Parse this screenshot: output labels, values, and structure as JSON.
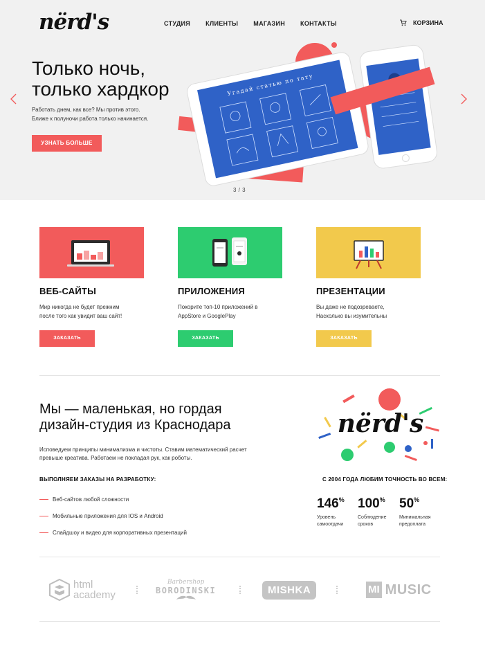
{
  "header": {
    "logo_text": "nërd's",
    "nav": [
      "СТУДИЯ",
      "КЛИЕНТЫ",
      "МАГАЗИН",
      "КОНТАКТЫ"
    ],
    "cart_label": "КОРЗИНА"
  },
  "hero": {
    "title_line1": "Только ночь,",
    "title_line2": "только хардкор",
    "text_line1": "Работать днем, как все? Мы против этого.",
    "text_line2": "Ближе к полуночи работа только начинается.",
    "button": "УЗНАТЬ БОЛЬШЕ",
    "pager": "3 / 3",
    "tablet_heading": "Угадай статью по тату",
    "accent_color": "#f25b5b"
  },
  "services": [
    {
      "title": "ВЕБ-САЙТЫ",
      "text_line1": "Мир никогда не будет прежним",
      "text_line2": "после того как увидит ваш сайт!",
      "button": "ЗАКАЗАТЬ",
      "color": "#f25b5b"
    },
    {
      "title": "ПРИЛОЖЕНИЯ",
      "text_line1": "Покорите топ-10 приложений в",
      "text_line2": "AppStore и GooglePlay",
      "button": "ЗАКАЗАТЬ",
      "color": "#2dcc70"
    },
    {
      "title": "ПРЕЗЕНТАЦИИ",
      "text_line1": "Вы даже не подозреваете,",
      "text_line2": "Насколько вы изумительны",
      "button": "ЗАКАЗАТЬ",
      "color": "#f2c94c"
    }
  ],
  "about": {
    "title_line1": "Мы — маленькая, но гордая",
    "title_line2": "дизайн-студия из Краснодара",
    "text_line1": "Исповедуем принципы минимализма и чистоты. Ставим математический расчет",
    "text_line2": "превыше креатива. Работаем не покладая рук, как роботы.",
    "orders_title": "ВЫПОЛНЯЕМ ЗАКАЗЫ НА РАЗРАБОТКУ:",
    "orders": [
      "Веб-сайтов любой сложности",
      "Мобильные приложения для IOS и Android",
      "Слайдшоу и видео для корпоративных презентаций"
    ],
    "logo_text": "nërd's",
    "accuracy_title": "С 2004 ГОДА ЛЮБИМ ТОЧНОСТЬ ВО ВСЕМ:",
    "stats": [
      {
        "value": "146",
        "unit": "%",
        "label_line1": "Уровень",
        "label_line2": "самоотдачи"
      },
      {
        "value": "100",
        "unit": "%",
        "label_line1": "Соблюдение",
        "label_line2": "сроков"
      },
      {
        "value": "50",
        "unit": "%",
        "label_line1": "Минимальная",
        "label_line2": "предоплата"
      }
    ]
  },
  "clients": {
    "html_academy_line1": "html",
    "html_academy_line2": "academy",
    "borodinski_top": "Barbershop",
    "borodinski": "BORODINSKI",
    "mishka": "MISHKA",
    "mi_music_badge": "MI",
    "mi_music": "MUSIC"
  }
}
